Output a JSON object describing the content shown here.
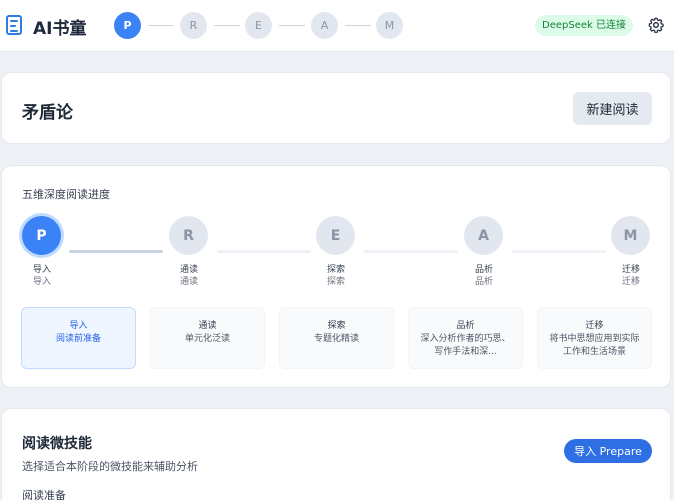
{
  "app": {
    "title": "AI书童",
    "connection_status": "DeepSeek 已连接"
  },
  "header_steps": [
    {
      "letter": "P",
      "active": true
    },
    {
      "letter": "R",
      "active": false
    },
    {
      "letter": "E",
      "active": false
    },
    {
      "letter": "A",
      "active": false
    },
    {
      "letter": "M",
      "active": false
    }
  ],
  "document": {
    "title": "矛盾论",
    "new_reading_label": "新建阅读"
  },
  "progress": {
    "title": "五维深度阅读进度",
    "steps": [
      {
        "letter": "P",
        "label": "导入",
        "sub": "导入"
      },
      {
        "letter": "R",
        "label": "通读",
        "sub": "通读"
      },
      {
        "letter": "E",
        "label": "探索",
        "sub": "探索"
      },
      {
        "letter": "A",
        "label": "品析",
        "sub": "品析"
      },
      {
        "letter": "M",
        "label": "迁移",
        "sub": "迁移"
      }
    ],
    "phases": [
      {
        "name": "导入",
        "desc": "阅读前准备"
      },
      {
        "name": "通读",
        "desc": "单元化泛读"
      },
      {
        "name": "探索",
        "desc": "专题化精读"
      },
      {
        "name": "品析",
        "desc": "深入分析作者的巧思、写作手法和深..."
      },
      {
        "name": "迁移",
        "desc": "将书中思想应用到实际工作和生活场景"
      }
    ]
  },
  "skills": {
    "title": "阅读微技能",
    "subtitle": "选择适合本阶段的微技能来辅助分析",
    "phase_badge": "导入 Prepare",
    "section_label": "阅读准备"
  },
  "colors": {
    "accent": "#3b82f6",
    "badge_green_bg": "#dcfce7",
    "badge_green_text": "#15803d"
  }
}
